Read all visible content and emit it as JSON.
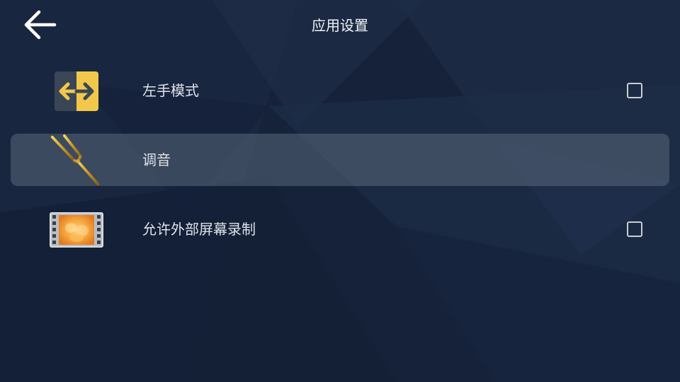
{
  "header": {
    "title": "应用设置"
  },
  "settings": [
    {
      "label": "左手模式",
      "icon": "left-right-arrows-icon",
      "checked": false,
      "highlighted": false
    },
    {
      "label": "调音",
      "icon": "tuning-fork-icon",
      "highlighted": true
    },
    {
      "label": "允许外部屏幕录制",
      "icon": "film-strip-icon",
      "checked": false,
      "highlighted": false
    }
  ],
  "colors": {
    "background": "#16233a",
    "highlight_row": "#3d4a5c",
    "accent_yellow": "#f2c84b"
  }
}
